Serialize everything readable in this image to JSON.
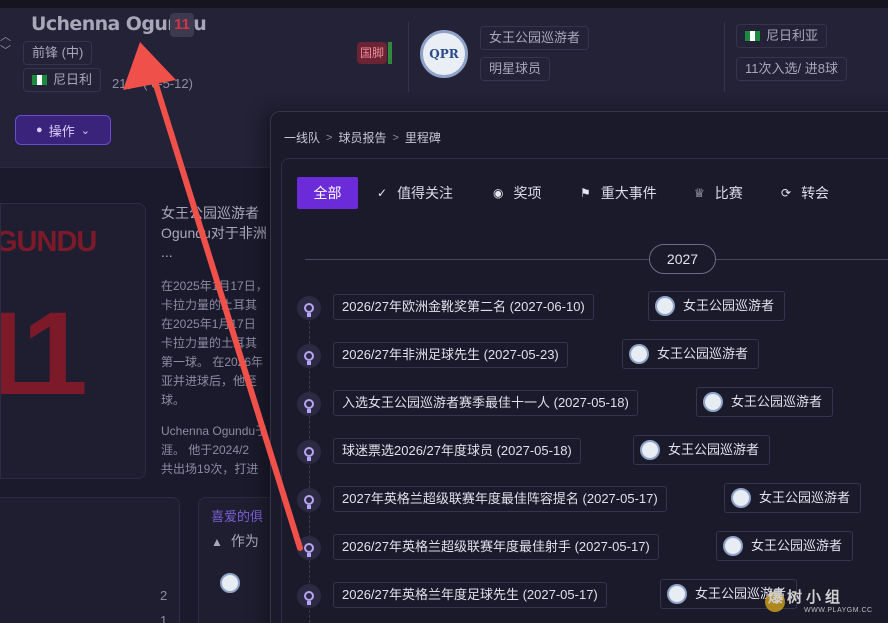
{
  "header": {
    "player_name": "Uchenna Ogundu",
    "shirt_number": "11",
    "position": "前锋 (中)",
    "nationality": "尼日利",
    "age_dob": "21岁 (  6-5-12)",
    "intl_badge": "国脚",
    "club": "女王公园巡游者",
    "status": "明星球员",
    "nation_full": "尼日利亚",
    "caps": "11次入选/ 进8球",
    "ops_button": "操作"
  },
  "background": {
    "jersey_name": "GUNDU",
    "jersey_number": "11",
    "bio_lead": [
      "女王公园巡游者",
      "Ogundu对于非洲",
      "..."
    ],
    "bio_lines": [
      "在2025年1月17日，",
      "卡拉力量的土耳其",
      "在2025年1月17日",
      "卡拉力量的土耳其",
      "第一球。 在2026年",
      "亚并进球后，他至",
      "球。"
    ],
    "bio_lines2": [
      "Uchenna Ogundu于",
      "涯。 他于2024/2",
      "共出场19次，打进"
    ],
    "fav_title": "喜爱的俱",
    "fav_sub": "作为",
    "numbers": [
      "2",
      "1"
    ]
  },
  "overlay": {
    "breadcrumb": [
      "一线队",
      "球员报告",
      "里程碑"
    ],
    "tabs": [
      {
        "label": "全部",
        "icon": ""
      },
      {
        "label": "值得关注",
        "icon": "check-icon"
      },
      {
        "label": "奖项",
        "icon": "medal-icon"
      },
      {
        "label": "重大事件",
        "icon": "flag-icon"
      },
      {
        "label": "比赛",
        "icon": "trophy-icon"
      },
      {
        "label": "转会",
        "icon": "refresh-icon"
      }
    ],
    "year": "2027",
    "milestones": [
      {
        "title": "2026/27年欧洲金靴奖第二名 (2027-06-10)",
        "club": "女王公园巡游者"
      },
      {
        "title": "2026/27年非洲足球先生 (2027-05-23)",
        "club": "女王公园巡游者"
      },
      {
        "title": "入选女王公园巡游者赛季最佳十一人 (2027-05-18)",
        "club": "女王公园巡游者"
      },
      {
        "title": "球迷票选2026/27年度球员 (2027-05-18)",
        "club": "女王公园巡游者"
      },
      {
        "title": "2027年英格兰超级联赛年度最佳阵容提名 (2027-05-17)",
        "club": "女王公园巡游者"
      },
      {
        "title": "2026/27年英格兰超级联赛年度最佳射手 (2027-05-17)",
        "club": "女王公园巡游者"
      },
      {
        "title": "2026/27年英格兰年度足球先生 (2027-05-17)",
        "club": "女王公园巡游者"
      }
    ]
  },
  "watermark": {
    "text": "爆树小组",
    "url": "WWW.PLAYGM.CC"
  },
  "colors": {
    "accent": "#6c2bd9",
    "arrow": "#f0504a",
    "jersey": "#7d1a2a"
  }
}
